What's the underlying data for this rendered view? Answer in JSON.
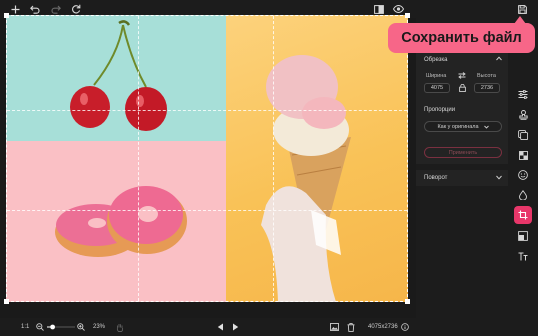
{
  "toolbar": {
    "icons": [
      "plus-icon",
      "undo-icon",
      "redo-icon",
      "reset-icon",
      "compare-icon",
      "preview-eye-icon",
      "save-icon"
    ]
  },
  "tooltip": {
    "text": "Сохранить файл"
  },
  "crop_panel": {
    "title": "Обрезка",
    "width_label": "Ширина",
    "height_label": "Высота",
    "width_value": "4075",
    "height_value": "2736",
    "proportions_title": "Пропорции",
    "proportions_selected": "Как у оригинала",
    "apply_label": "Применить"
  },
  "rotate_panel": {
    "title": "Поворот"
  },
  "tools": [
    "adjust-icon",
    "stamp-icon",
    "replace-bg-icon",
    "mosaic-icon",
    "face-icon",
    "retouch-icon",
    "crop-icon",
    "resize-icon",
    "text-icon"
  ],
  "active_tool": "crop-icon",
  "bottom": {
    "ratio_label": "1:1",
    "zoom_value": "23%",
    "zoom_level": 0.2,
    "dimensions": "4075x2736"
  },
  "colors": {
    "accent": "#e8376a",
    "tooltip_bg": "#f76688",
    "app_bg": "#1c1c1c",
    "panel_section_bg": "#232323"
  }
}
